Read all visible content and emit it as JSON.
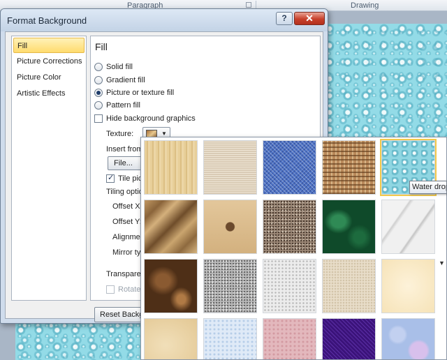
{
  "ribbon": {
    "group_paragraph": "Paragraph",
    "group_drawing": "Drawing"
  },
  "dialog": {
    "title": "Format Background",
    "help_label": "?",
    "close_label": "✕",
    "nav": [
      {
        "label": "Fill"
      },
      {
        "label": "Picture Corrections"
      },
      {
        "label": "Picture Color"
      },
      {
        "label": "Artistic Effects"
      }
    ],
    "panel": {
      "heading": "Fill",
      "radios": [
        {
          "label": "Solid fill"
        },
        {
          "label": "Gradient fill"
        },
        {
          "label": "Picture or texture fill"
        },
        {
          "label": "Pattern fill"
        }
      ],
      "hide_background_graphics": "Hide background graphics",
      "texture_label": "Texture:",
      "insert_from_label": "Insert from",
      "file_button": "File...",
      "tile_picture_label": "Tile pic",
      "tiling_options_label": "Tiling optio",
      "offset_x_label": "Offset X:",
      "offset_y_label": "Offset Y:",
      "alignment_label": "Alignmen",
      "mirror_type_label": "Mirror ty:",
      "transparency_label": "Transparen",
      "rotate_label": "Rotate",
      "reset_button": "Reset Backgr"
    }
  },
  "gallery": {
    "tooltip": "Water drop",
    "scroll_arrow": "▼"
  }
}
